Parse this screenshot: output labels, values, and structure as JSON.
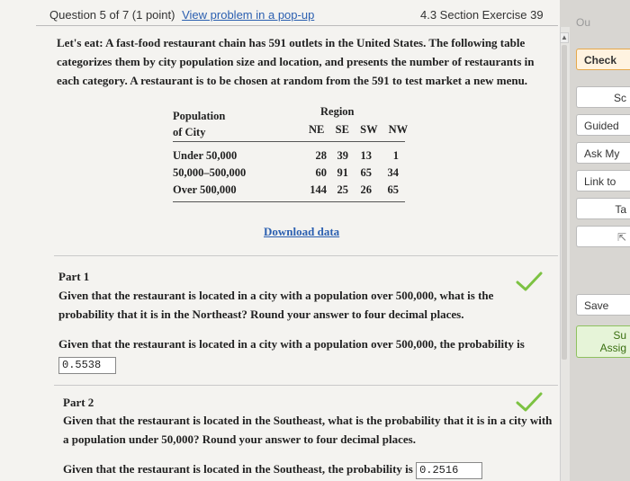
{
  "header": {
    "question_label": "Question 5 of 7 (1 point)",
    "popup_link": "View problem in a pop-up",
    "section": "4.3 Section Exercise 39"
  },
  "intro": "Let's eat: A fast-food restaurant chain has 591 outlets in the United States. The following table categorizes them by city population size and location, and presents the number of restaurants in each category. A restaurant is to be chosen at random from the 591 to test market a new menu.",
  "table": {
    "row_header_line1": "Population",
    "row_header_line2": "of City",
    "col_group": "Region",
    "columns": "NE  SE  SW  NW",
    "rows": [
      {
        "label": "Under 50,000",
        "values": [
          "28",
          "39",
          "13",
          "1"
        ]
      },
      {
        "label": "50,000–500,000",
        "values": [
          "60",
          "91",
          "65",
          "34"
        ]
      },
      {
        "label": "Over 500,000",
        "values": [
          "144",
          "25",
          "26",
          "65"
        ]
      }
    ]
  },
  "download_link": "Download data",
  "part1": {
    "title": "Part 1",
    "question": "Given that the restaurant is located in a city with a population over 500,000, what is the probability that it is in the Northeast? Round your answer to four decimal places.",
    "answer_prefix": "Given that the restaurant is located in a city with a population over 500,000, the probability is",
    "answer_value": "0.5538"
  },
  "part2": {
    "title": "Part 2",
    "question": "Given that the restaurant is located in the Southeast, what is the probability that it is in a city with a population under 50,000? Round your answer to four decimal places.",
    "answer_prefix": "Given that the restaurant is located in the Southeast, the probability is",
    "answer_value": "0.2516"
  },
  "right_panel": {
    "top_label": "Ou",
    "check": "Check",
    "sc": "Sc",
    "guided": "Guided",
    "ask": "Ask My",
    "link": "Link to",
    "ta": "Ta",
    "save": "Save",
    "submit_line1": "Su",
    "submit_line2": "Assig"
  },
  "colors": {
    "link": "#2b5fb0",
    "check_green": "#7cc242",
    "check_button_border": "#e6a84a"
  }
}
